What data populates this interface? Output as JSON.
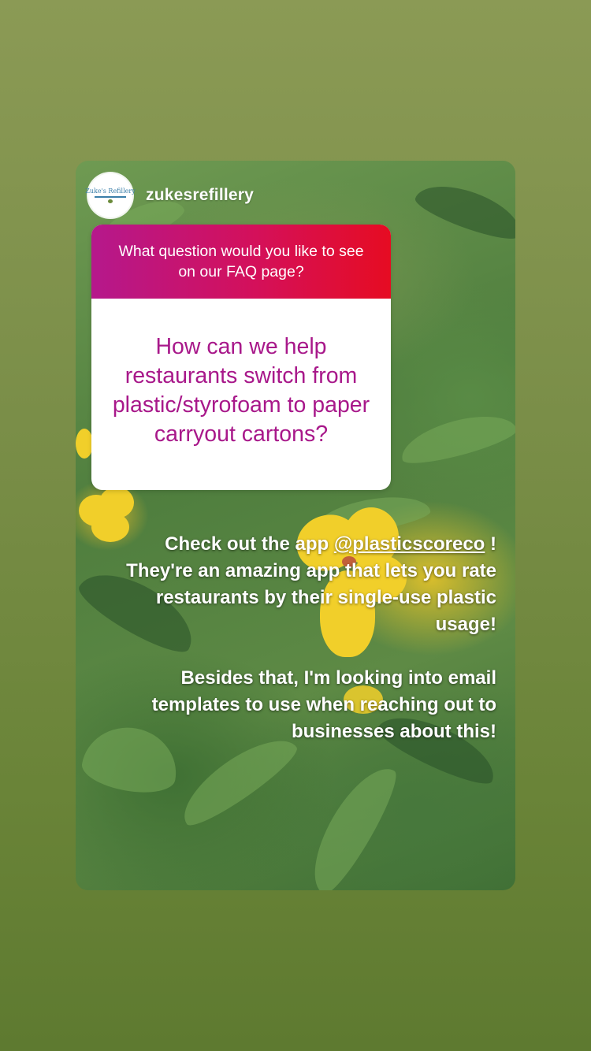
{
  "story": {
    "username": "zukesrefillery",
    "avatar_text": "Zuke's Refillery"
  },
  "question_sticker": {
    "prompt": "What question would you like to see on our FAQ page?",
    "answer": "How can we help restaurants switch from plastic/styrofoam to paper carryout cartons?",
    "gradient_colors": [
      "#b5188c",
      "#e60c22"
    ],
    "answer_color": "#a8188a"
  },
  "caption": {
    "line1_before": "Check out the app ",
    "mention": "@plasticscoreco",
    "line1_after": " ! They're an amazing app that lets you rate restaurants by their single-use plastic usage!",
    "paragraph2": "Besides that, I'm looking into email templates to use when reaching out to businesses about this!"
  },
  "background_photo": {
    "subject": "yellow flowers and fern-like green foliage"
  }
}
